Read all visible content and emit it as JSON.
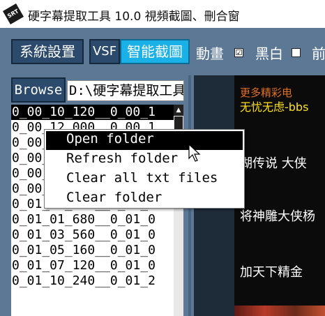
{
  "window": {
    "icon_text": "SRT",
    "title": "硬字幕提取工具 10.0  視頻截圖、刪合窗"
  },
  "toolbar": {
    "settings_label": "系統設置",
    "vsf_label": "VSF",
    "smart_capture_label": "智能截圖",
    "animation_label": "動畫",
    "animation_checked": "☑",
    "bw_label": "黑白",
    "bw_checked": "",
    "front_label": "前"
  },
  "browse": {
    "button_label": "Browse",
    "path_value": "D:\\硬字幕提取工具"
  },
  "file_list": [
    "0_00_10_120__0_00_1",
    "0_00_12_000__0_00_1",
    "0_00_13_000__0_00_1",
    "0_00_15_000__0_00_1",
    "0_00_17_000__0_00_1",
    "0_00_19_000__0_00_2",
    "0_01_00_000__0_01_0",
    "0_01_01_680__0_01_0",
    "0_01_03_560__0_01_0",
    "0_01_05_160__0_01_0",
    "0_01_07_120__0_01_0",
    "0_01_10_240__0_01_2"
  ],
  "context_menu": {
    "items": [
      "Open folder",
      "Refresh folder",
      "Clear all txt files",
      "Clear folder"
    ]
  },
  "video": {
    "line1": "更多精彩电",
    "line2": "无忧无虑-bbs",
    "line3": "湖传说 大侠",
    "line4": "将神雕大侠杨",
    "line5": "加天下精金"
  },
  "colors": {
    "window_bg": "#5c7894",
    "button_bg": "#2c4a6c",
    "accent_cyan": "#1ab0e8"
  }
}
